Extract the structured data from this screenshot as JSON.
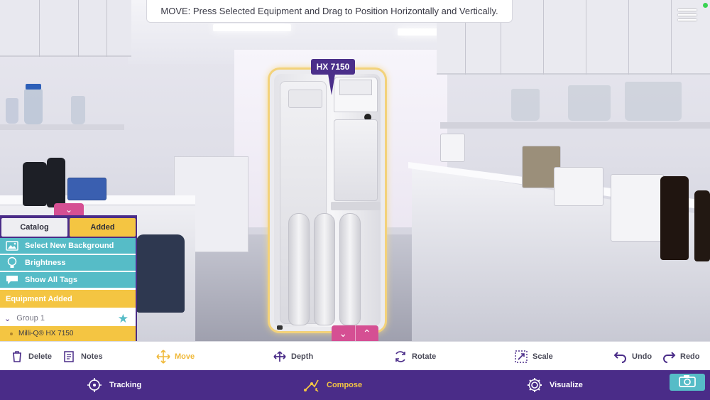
{
  "instruction": "MOVE: Press Selected Equipment and Drag to Position Horizontally and Vertically.",
  "equipment": {
    "tag": "HX 7150"
  },
  "panel": {
    "tabs": [
      {
        "label": "Catalog",
        "selected": false
      },
      {
        "label": "Added",
        "selected": true
      }
    ],
    "actions": [
      {
        "label": "Select New Background",
        "icon": "image-icon"
      },
      {
        "label": "Brightness",
        "icon": "lightbulb-icon"
      },
      {
        "label": "Show All Tags",
        "icon": "speech-bubble-icon"
      }
    ],
    "section_title": "Equipment Added",
    "group": {
      "label": "Group 1",
      "favorite": true
    },
    "item": {
      "label": "Milli-Q® HX 7150"
    }
  },
  "toolbar": {
    "delete": "Delete",
    "notes": "Notes",
    "move": "Move",
    "depth": "Depth",
    "rotate": "Rotate",
    "scale": "Scale",
    "undo": "Undo",
    "redo": "Redo",
    "active": "Move"
  },
  "nav": {
    "tracking": "Tracking",
    "compose": "Compose",
    "visualize": "Visualize",
    "active": "Compose"
  },
  "colors": {
    "brand_purple": "#4a2c88",
    "accent_yellow": "#f4c542",
    "teal": "#56bcc7",
    "handle_pink": "#d54f93"
  }
}
